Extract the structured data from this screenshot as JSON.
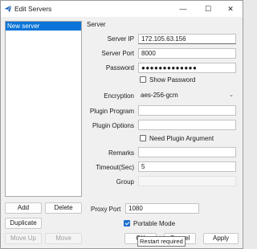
{
  "window": {
    "title": "Edit Servers",
    "minimize_glyph": "—",
    "maximize_glyph": "☐",
    "close_glyph": "✕"
  },
  "servers": {
    "items": [
      "New server"
    ]
  },
  "list_buttons": {
    "add": "Add",
    "delete": "Delete",
    "duplicate": "Duplicate",
    "move_up": "Move Up",
    "move_down": "Move"
  },
  "server": {
    "group_title": "Server",
    "ip_label": "Server IP",
    "ip_value": "172.105.63.156",
    "port_label": "Server Port",
    "port_value": "8000",
    "password_label": "Password",
    "password_value": "●●●●●●●●●●●●●",
    "show_password_label": "Show Password",
    "show_password_checked": false,
    "encryption_label": "Encryption",
    "encryption_value": "aes-256-gcm",
    "plugin_program_label": "Plugin Program",
    "plugin_program_value": "",
    "plugin_options_label": "Plugin Options",
    "plugin_options_value": "",
    "need_plugin_argument_label": "Need Plugin Argument",
    "need_plugin_argument_checked": false,
    "remarks_label": "Remarks",
    "remarks_value": "",
    "timeout_label": "Timeout(Sec)",
    "timeout_value": "5",
    "group_label": "Group",
    "group_value": ""
  },
  "proxy": {
    "port_label": "Proxy Port",
    "port_value": "1080",
    "portable_mode_label": "Portable Mode",
    "portable_mode_checked": true
  },
  "footer": {
    "ok": "OK",
    "cancel": "Cancel",
    "apply": "Apply",
    "tooltip": "Restart required"
  },
  "colors": {
    "accent": "#0a74d8",
    "app_icon": "#1f63b8"
  }
}
